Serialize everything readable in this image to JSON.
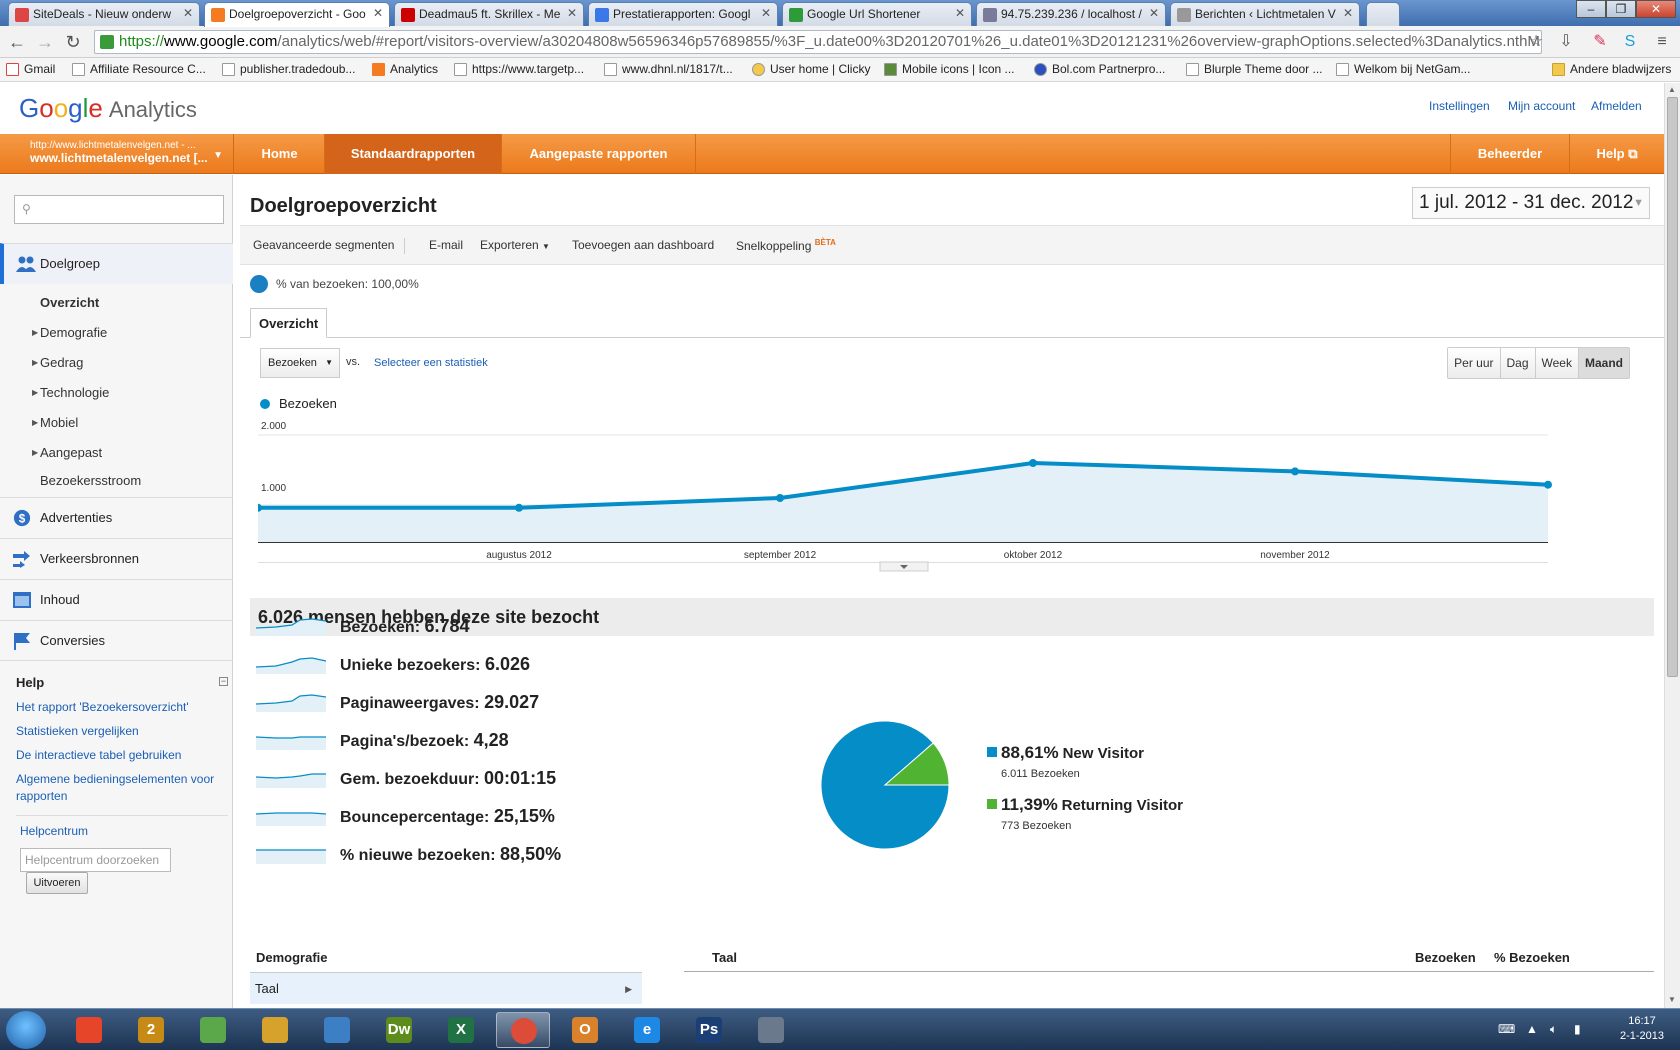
{
  "browser": {
    "tabs": [
      {
        "label": "SiteDeals - Nieuw onderw",
        "active": false,
        "color": "#d44"
      },
      {
        "label": "Doelgroepoverzicht - Goo",
        "active": true,
        "color": "#f47b20"
      },
      {
        "label": "Deadmau5 ft. Skrillex - Me",
        "active": false,
        "color": "#cc0000"
      },
      {
        "label": "Prestatierapporten: Googl",
        "active": false,
        "color": "#3b78e7"
      },
      {
        "label": "Google Url Shortener",
        "active": false,
        "color": "#2e9a3a"
      },
      {
        "label": "94.75.239.236 / localhost /",
        "active": false,
        "color": "#7a7a9a"
      },
      {
        "label": "Berichten ‹ Lichtmetalen V",
        "active": false,
        "color": "#999999"
      }
    ],
    "url": {
      "scheme": "https://",
      "host": "www.google.com",
      "path": "/analytics/web/#report/visitors-overview/a30204808w56596346p57689855/%3F_u.date00%3D20120701%26_u.date01%3D20121231%26overview-graphOptions.selected%3Danalytics.nthM"
    },
    "bookmarks": [
      "Gmail",
      "Affiliate Resource C...",
      "publisher.tradedoub...",
      "Analytics",
      "https://www.targetp...",
      "www.dhnl.nl/1817/t...",
      "User home | Clicky",
      "Mobile icons | Icon ...",
      "Bol.com Partnerpro...",
      "Blurple Theme door ...",
      "Welkom bij NetGam...",
      "Andere bladwijzers"
    ]
  },
  "header": {
    "logo_google": "Google",
    "logo_analytics": "Analytics",
    "links": [
      "Instellingen",
      "Mijn account",
      "Afmelden"
    ]
  },
  "nav": {
    "profile_url": "http://www.lichtmetalenvelgen.net - ...",
    "profile_name": "www.lichtmetalenvelgen.net [...",
    "items": [
      "Home",
      "Standaardrapporten",
      "Aangepaste rapporten"
    ],
    "right_items": [
      "Beheerder",
      "Help"
    ]
  },
  "sidebar": {
    "search_placeholder": "",
    "sections": [
      "Doelgroep",
      "Advertenties",
      "Verkeersbronnen",
      "Inhoud",
      "Conversies"
    ],
    "sub_items": [
      "Overzicht",
      "Demografie",
      "Gedrag",
      "Technologie",
      "Mobiel",
      "Aangepast",
      "Bezoekersstroom"
    ],
    "help": {
      "title": "Help",
      "links": [
        "Het rapport 'Bezoekersoverzicht'",
        "Statistieken vergelijken",
        "De interactieve tabel gebruiken",
        "Algemene bedieningselementen voor rapporten"
      ],
      "helpcenter": "Helpcentrum",
      "search_placeholder": "Helpcentrum doorzoeken",
      "button": "Uitvoeren"
    }
  },
  "report": {
    "title": "Doelgroepoverzicht",
    "date_range": "1 jul. 2012 - 31 dec. 2012",
    "actions": [
      "Geavanceerde segmenten",
      "E-mail",
      "Exporteren",
      "Toevoegen aan dashboard",
      "Snelkoppeling"
    ],
    "beta": "BÈTA",
    "segment": "% van bezoeken: 100,00%",
    "tab": "Overzicht",
    "metric_select": "Bezoeken",
    "vs": "vs.",
    "select_stat": "Selecteer een statistiek",
    "granularity": [
      "Per uur",
      "Dag",
      "Week",
      "Maand"
    ],
    "summary_title": "6.026 mensen hebben deze site bezocht"
  },
  "chart_data": {
    "type": "line",
    "series": [
      {
        "name": "Bezoeken",
        "values": [
          960,
          960,
          1100,
          1600,
          1480,
          1290
        ]
      }
    ],
    "x": [
      "jul 2012",
      "augustus 2012",
      "september 2012",
      "oktober 2012",
      "november 2012",
      "december 2012"
    ],
    "tick_labels": [
      "augustus 2012",
      "september 2012",
      "oktober 2012",
      "november 2012"
    ],
    "y_ticks": [
      "2.000",
      "1.000"
    ],
    "ylim": [
      0,
      2000
    ],
    "color": "#058dc7"
  },
  "metrics": [
    {
      "label": "Bezoeken:",
      "value": "6.784"
    },
    {
      "label": "Unieke bezoekers:",
      "value": "6.026"
    },
    {
      "label": "Paginaweergaves:",
      "value": "29.027"
    },
    {
      "label": "Pagina's/bezoek:",
      "value": "4,28"
    },
    {
      "label": "Gem. bezoekduur:",
      "value": "00:01:15"
    },
    {
      "label": "Bouncepercentage:",
      "value": "25,15%"
    },
    {
      "label": "% nieuwe bezoeken:",
      "value": "88,50%"
    }
  ],
  "pie": {
    "slices": [
      {
        "pct": "88,61%",
        "name": "New Visitor",
        "sub": "6.011 Bezoeken",
        "value": 88.61,
        "color": "#058dc7"
      },
      {
        "pct": "11,39%",
        "name": "Returning Visitor",
        "sub": "773 Bezoeken",
        "value": 11.39,
        "color": "#50b432"
      }
    ]
  },
  "bottom": {
    "demo_header": "Demografie",
    "demo_row": "Taal",
    "taal_header": "Taal",
    "col_visits": "Bezoeken",
    "col_pct": "% Bezoeken"
  },
  "taskbar": {
    "time": "16:17",
    "date": "2-1-2013",
    "apps": [
      {
        "glyph": "",
        "color": "#e6452a"
      },
      {
        "glyph": "2",
        "color": "#c78a14"
      },
      {
        "glyph": "",
        "color": "#5ba84a"
      },
      {
        "glyph": "",
        "color": "#d6a22c"
      },
      {
        "glyph": "",
        "color": "#3c7fc4"
      },
      {
        "glyph": "Dw",
        "color": "#5e8c1c"
      },
      {
        "glyph": "X",
        "color": "#207245"
      },
      {
        "glyph": "",
        "color": "#dd4b39"
      },
      {
        "glyph": "O",
        "color": "#d9822b"
      },
      {
        "glyph": "e",
        "color": "#1e88e5"
      },
      {
        "glyph": "Ps",
        "color": "#1b3f74"
      },
      {
        "glyph": "",
        "color": "#6a7a8c"
      }
    ]
  }
}
